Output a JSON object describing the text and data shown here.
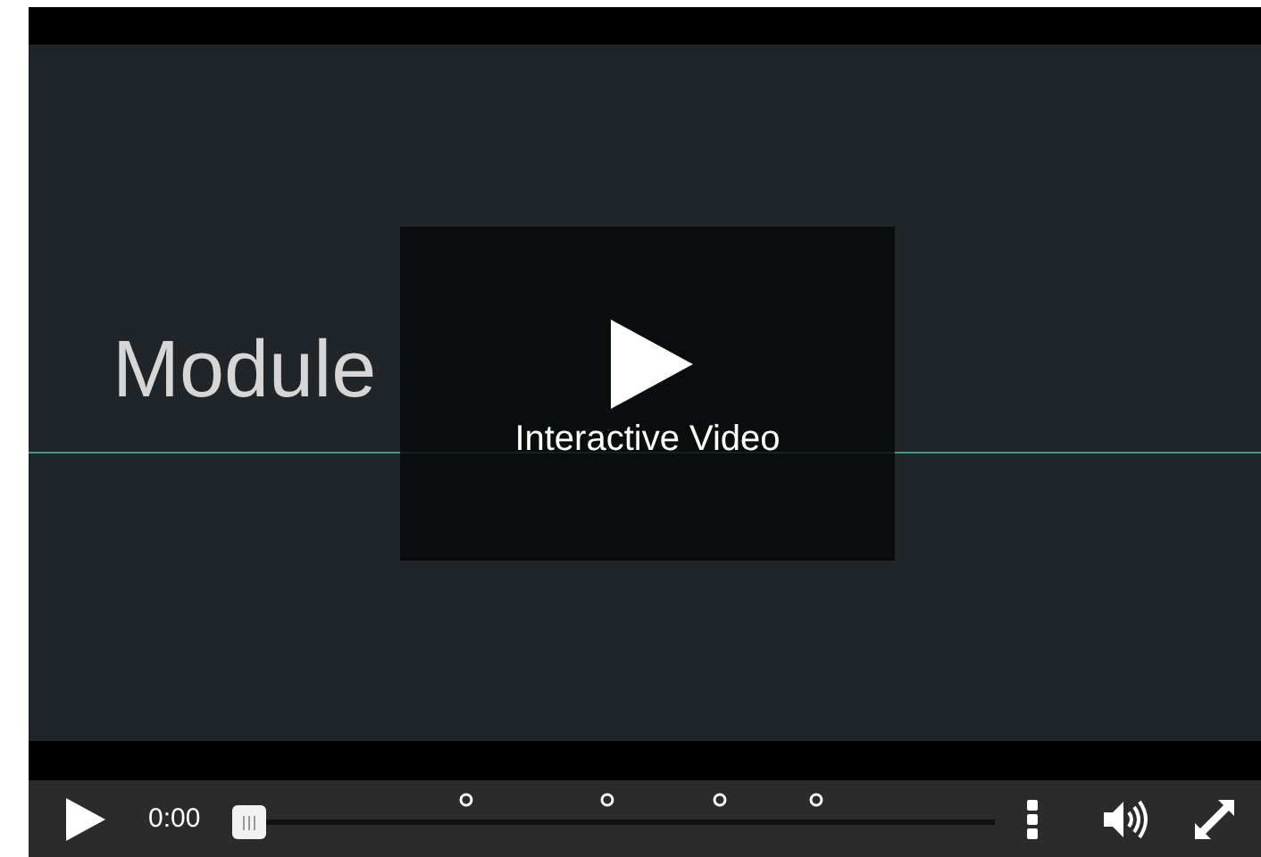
{
  "video": {
    "slide_title": "Module"
  },
  "overlay": {
    "label": "Interactive Video"
  },
  "controls": {
    "time": "0:00",
    "progress": {
      "level": 0
    }
  }
}
